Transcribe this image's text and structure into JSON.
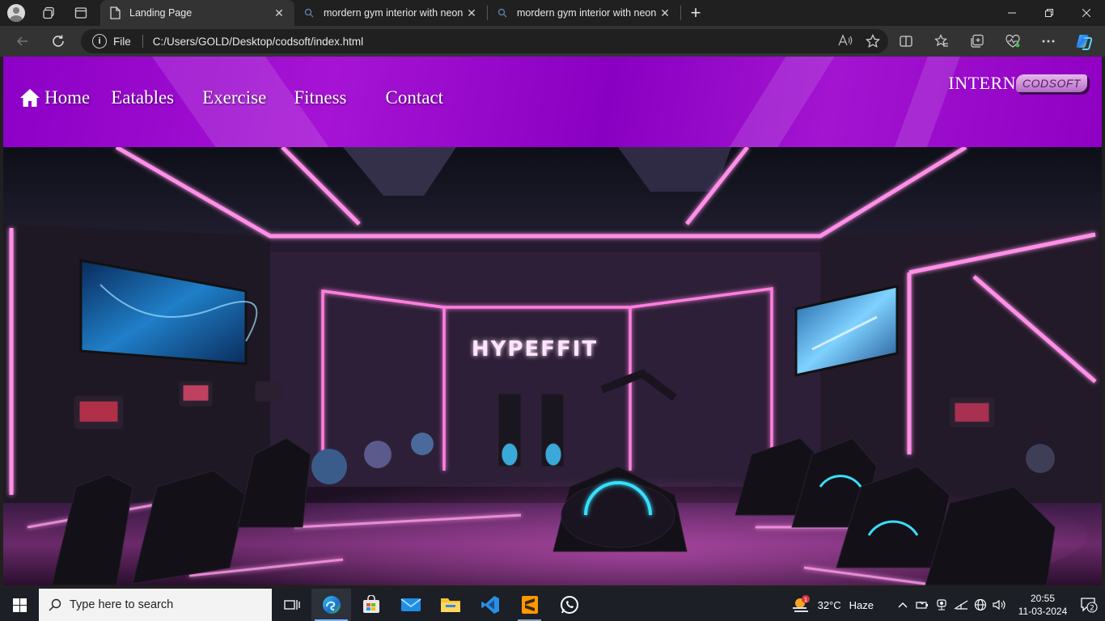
{
  "browser": {
    "tabs": [
      {
        "title": "Landing Page",
        "active": true,
        "icon": "page-icon"
      },
      {
        "title": "mordern gym interior with neon",
        "active": false,
        "icon": "search-icon"
      },
      {
        "title": "mordern gym interior with neon",
        "active": false,
        "icon": "search-icon"
      }
    ],
    "address": {
      "scheme_label": "File",
      "url": "C:/Users/GOLD/Desktop/codsoft/index.html"
    }
  },
  "page": {
    "nav": {
      "items": [
        "Home",
        "Eatables",
        "Exercise",
        "Fitness",
        "Contact"
      ]
    },
    "brand": {
      "main": "INTERN",
      "badge": "CODSOFT"
    },
    "hero": {
      "sign_text": "HYPEFFIT"
    }
  },
  "taskbar": {
    "search_placeholder": "Type here to search",
    "weather": {
      "temp": "32°C",
      "condition": "Haze",
      "badge": "1"
    },
    "clock": {
      "time": "20:55",
      "date": "11-03-2024"
    },
    "notifications": "2"
  },
  "colors": {
    "nav_purple": "#9a0ccc",
    "neon_pink": "#ff5fd0"
  }
}
